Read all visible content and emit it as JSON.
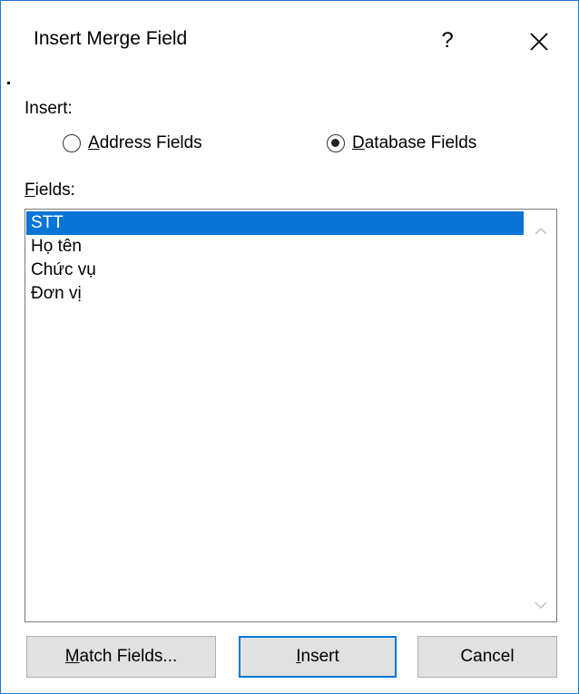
{
  "dialog": {
    "title": "Insert Merge Field",
    "help_label": "?",
    "close_label": "✕"
  },
  "insert_group": {
    "label": "Insert:",
    "options": [
      {
        "label_first": "A",
        "label_rest": "ddress Fields",
        "selected": false
      },
      {
        "label_first": "D",
        "label_rest": "atabase Fields",
        "selected": true
      }
    ]
  },
  "fields": {
    "label_first": "F",
    "label_rest": "ields:",
    "items": [
      "STT",
      "Họ tên",
      "Chức vụ",
      "Đơn vị"
    ],
    "selected_index": 0
  },
  "buttons": {
    "match_first": "M",
    "match_rest": "atch Fields...",
    "insert_first": "I",
    "insert_rest": "nsert",
    "cancel": "Cancel"
  },
  "colors": {
    "accent": "#0078d7",
    "selection": "#0a74d6",
    "border": "#1a7bd4"
  }
}
